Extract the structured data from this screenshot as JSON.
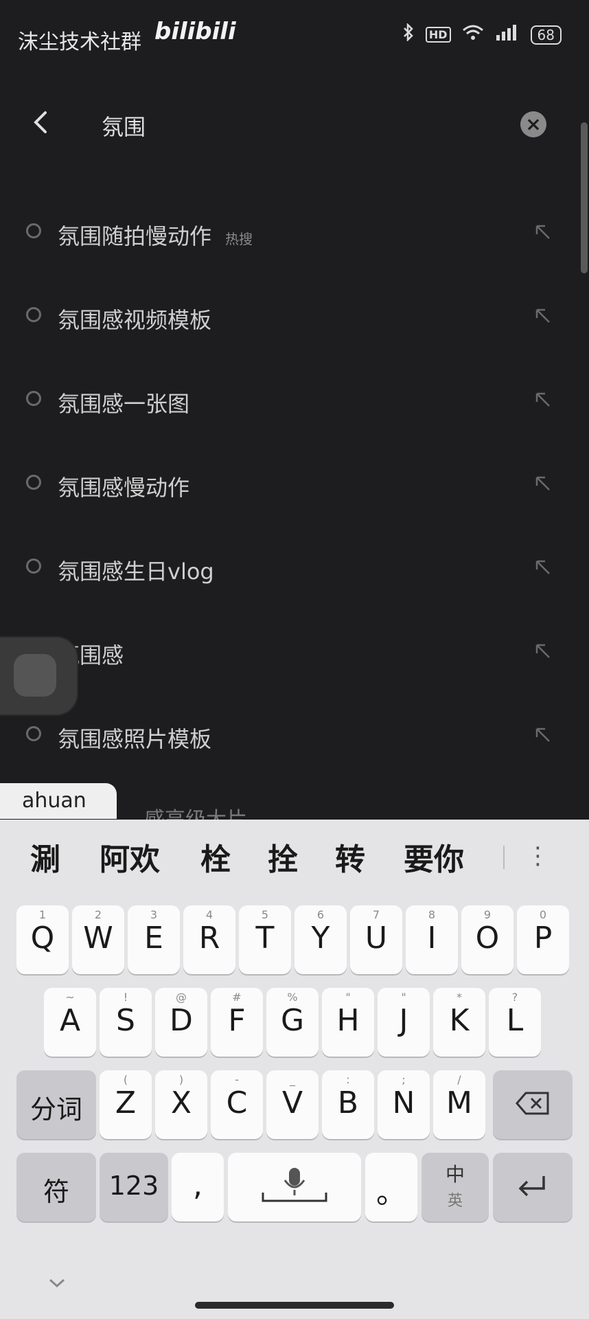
{
  "status_bar": {
    "left_text": "沫尘技术社群",
    "logo": "bilibili",
    "icons": [
      "bluetooth-icon",
      "hd-icon",
      "wifi-icon",
      "signal-icon"
    ],
    "hd_label": "HD",
    "battery": "68"
  },
  "search": {
    "query": "氛围",
    "back_icon": "back-arrow-icon",
    "clear_icon": "clear-icon"
  },
  "suggestions": [
    {
      "text": "氛围随拍慢动作",
      "tag": "热搜"
    },
    {
      "text": "氛围感视频模板"
    },
    {
      "text": "氛围感一张图"
    },
    {
      "text": "氛围感慢动作"
    },
    {
      "text": "氛围感生日vlog"
    },
    {
      "text": "氛围感"
    },
    {
      "text": "氛围感照片模板"
    }
  ],
  "partial_suggestion": "感高级大片",
  "ime": {
    "pinyin": "ahuan",
    "candidates": [
      "涮",
      "阿欢",
      "栓",
      "拴",
      "转",
      "要你"
    ],
    "more_icon": "more-vertical-icon"
  },
  "keyboard": {
    "row1": [
      {
        "main": "Q",
        "sub": "1"
      },
      {
        "main": "W",
        "sub": "2"
      },
      {
        "main": "E",
        "sub": "3"
      },
      {
        "main": "R",
        "sub": "4"
      },
      {
        "main": "T",
        "sub": "5"
      },
      {
        "main": "Y",
        "sub": "6"
      },
      {
        "main": "U",
        "sub": "7"
      },
      {
        "main": "I",
        "sub": "8"
      },
      {
        "main": "O",
        "sub": "9"
      },
      {
        "main": "P",
        "sub": "0"
      }
    ],
    "row2": [
      {
        "main": "A",
        "sub": "~"
      },
      {
        "main": "S",
        "sub": "!"
      },
      {
        "main": "D",
        "sub": "@"
      },
      {
        "main": "F",
        "sub": "#"
      },
      {
        "main": "G",
        "sub": "%"
      },
      {
        "main": "H",
        "sub": "\""
      },
      {
        "main": "J",
        "sub": "\""
      },
      {
        "main": "K",
        "sub": "*"
      },
      {
        "main": "L",
        "sub": "?"
      }
    ],
    "row3": [
      {
        "main": "Z",
        "sub": "("
      },
      {
        "main": "X",
        "sub": ")"
      },
      {
        "main": "C",
        "sub": "-"
      },
      {
        "main": "V",
        "sub": "_"
      },
      {
        "main": "B",
        "sub": ":"
      },
      {
        "main": "N",
        "sub": ";"
      },
      {
        "main": "M",
        "sub": "/"
      }
    ],
    "segment_label": "分词",
    "symbols_label": "符",
    "numbers_label": "123",
    "comma_label": ",",
    "period_label": "。",
    "lang_label": "中",
    "lang_sub": "英",
    "mic_icon": "microphone-icon",
    "backspace_icon": "backspace-icon",
    "enter_icon": "enter-icon",
    "collapse_icon": "chevron-down-icon"
  }
}
